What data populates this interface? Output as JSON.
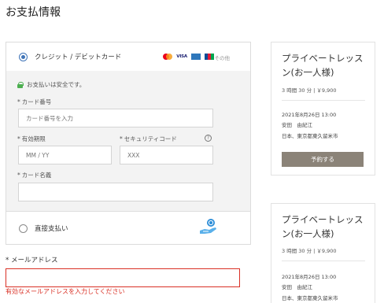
{
  "page": {
    "title": "お支払情報"
  },
  "payment": {
    "card_option_label": "クレジット / デビットカード",
    "brands": [
      "mastercard-icon",
      "visa-icon",
      "amex-icon",
      "jcb-icon"
    ],
    "visa_text": "VISA",
    "brands_other": "その他",
    "secure_text": "お支払いは安全です。",
    "card_number": {
      "label": "カード番号",
      "placeholder": "カード番号を入力"
    },
    "expiry": {
      "label": "有効期限",
      "placeholder": "MM / YY"
    },
    "cvc": {
      "label": "セキュリティコード",
      "placeholder": "XXX",
      "info": "?"
    },
    "card_name": {
      "label": "カード名義",
      "placeholder": ""
    },
    "direct_option_label": "直接支払い",
    "required_mark": "*"
  },
  "email": {
    "label": "メールアドレス",
    "value": "",
    "error": "有効なメールアドレスを入力してください"
  },
  "summary_cards": [
    {
      "title": "プライベートレッスン(お一人様)",
      "meta": "3 時間 30 分 | ￥9,900",
      "date": "2021年8月26日 13:00",
      "person": "安田　由紀江",
      "location": "日本、東京都東久留米市",
      "button": "予約する"
    },
    {
      "title": "プライベートレッスン(お一人様)",
      "meta": "3 時間 30 分 | ￥9,900",
      "date": "2021年8月26日 13:00",
      "person": "安田　由紀江",
      "location": "日本、東京都東久留米市"
    }
  ],
  "colors": {
    "accent": "#3f74b7",
    "error": "#d93025",
    "button_bg": "#8b8378",
    "panel_bg": "#f3f3f3",
    "secure_green": "#4caf50"
  }
}
